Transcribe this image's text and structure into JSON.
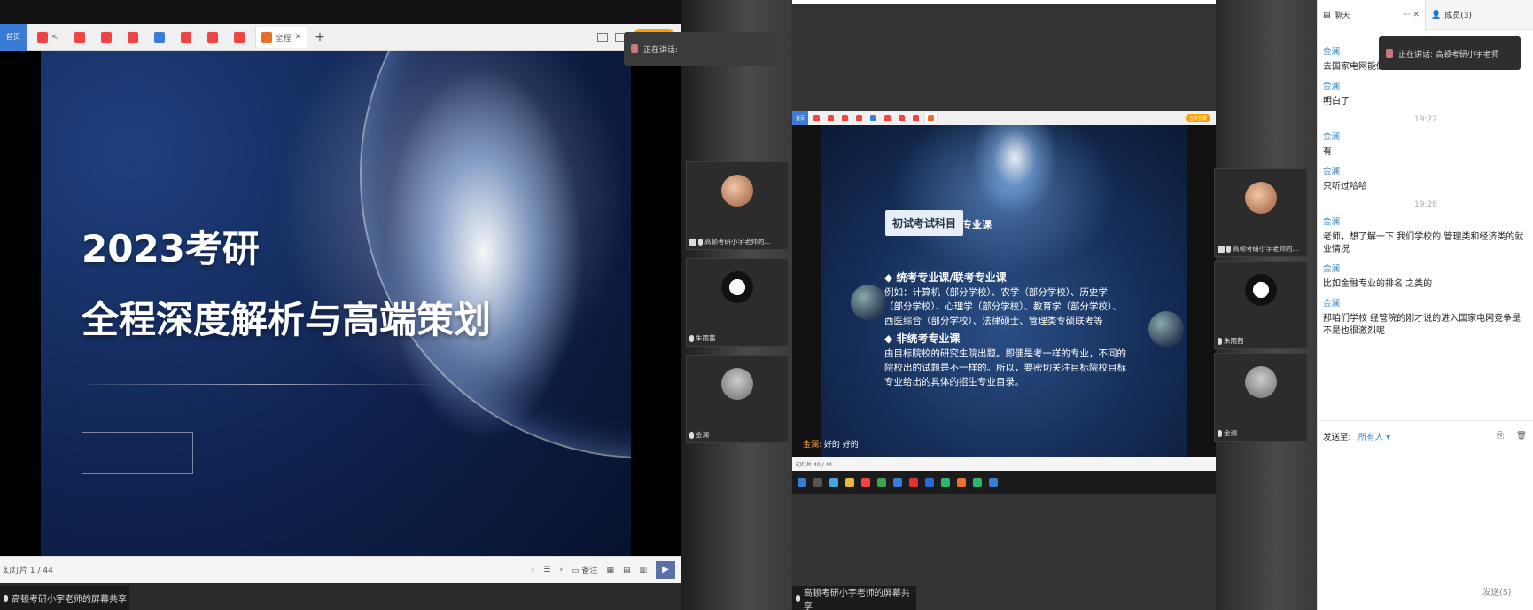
{
  "left": {
    "tabs": [
      {
        "label": "首页",
        "active": false,
        "kind": "home"
      },
      {
        "label": "<",
        "active": false,
        "kind": "pdf"
      },
      {
        "label": "",
        "active": false,
        "kind": "pdf"
      },
      {
        "label": "",
        "active": false,
        "kind": "pdf"
      },
      {
        "label": "",
        "active": false,
        "kind": "pdf"
      },
      {
        "label": "",
        "active": false,
        "kind": "doc"
      },
      {
        "label": "",
        "active": false,
        "kind": "pdf"
      },
      {
        "label": "",
        "active": false,
        "kind": "pdf"
      },
      {
        "label": "",
        "active": false,
        "kind": "pdf"
      },
      {
        "label": "全程",
        "active": true,
        "kind": "ppt"
      }
    ],
    "login_label": "立即登录",
    "slide": {
      "title_line1": "2023考研",
      "title_line2": "全程深度解析与高端策划"
    },
    "status": {
      "page": "幻灯片 1 / 44",
      "notes_label": "备注"
    },
    "share_label": "高顿考研小宇老师的屏幕共享",
    "speaking_label": "正在讲话:",
    "participants": [
      {
        "name": "高顿考研小宇老师的..."
      },
      {
        "name": "朱雨茜"
      },
      {
        "name": "金澜"
      }
    ]
  },
  "right": {
    "slide": {
      "tag": "初试考试科目",
      "tag2": "专业课",
      "head1": "◆ 统考专业课/联考专业课",
      "text1_l1": "例如：计算机（部分学校）、农学（部分学校）、历史学",
      "text1_l2": "（部分学校）、心理学（部分学校）、教育学（部分学校）、",
      "text1_l3": "西医综合（部分学校）、法律硕士、管理类专硕联考等",
      "head2": "◆ 非统考专业课",
      "text2_l1": "由目标院校的研究生院出题。即便是考一样的专业，不同的",
      "text2_l2": "院校出的试题是不一样的。所以，要密切关注目标院校目标",
      "text2_l3": "专业给出的具体的招生专业目录。"
    },
    "overlay_name": "金澜:",
    "overlay_msg": "好的 好的",
    "inner_status": "幻灯片 40 / 44",
    "share_label": "高顿考研小宇老师的屏幕共享",
    "speaking_label": "正在讲话: 高顿考研小宇老师",
    "participants": [
      {
        "name": "高顿考研小宇老师的..."
      },
      {
        "name": "朱雨茜"
      },
      {
        "name": "金澜"
      }
    ]
  },
  "chat": {
    "tab_chat": "聊天",
    "tab_members": "成员(3)",
    "messages": [
      {
        "type": "msg",
        "name": "金澜",
        "text": "去国家电网能做什么呢"
      },
      {
        "type": "msg",
        "name": "金澜",
        "text": "明白了"
      },
      {
        "type": "time",
        "text": "19:22"
      },
      {
        "type": "msg",
        "name": "金澜",
        "text": "有"
      },
      {
        "type": "msg",
        "name": "金澜",
        "text": "只听过哈哈"
      },
      {
        "type": "time",
        "text": "19:28"
      },
      {
        "type": "msg",
        "name": "金澜",
        "text": "老师，想了解一下 我们学校的 管理类和经济类的就业情况"
      },
      {
        "type": "msg",
        "name": "金澜",
        "text": "比如金融专业的排名 之类的"
      },
      {
        "type": "msg",
        "name": "金澜",
        "text": "那咱们学校 经管院的刚才说的进入国家电网竞争是不是也很激烈呢"
      }
    ],
    "send_to_label": "发送至:",
    "send_to_value": "所有人",
    "input_placeholder": "",
    "send_button": "发送(S)"
  }
}
